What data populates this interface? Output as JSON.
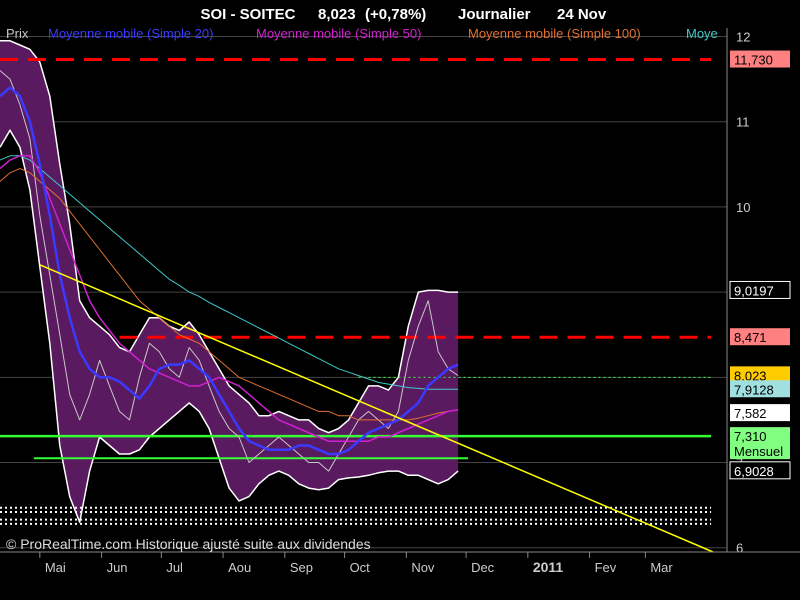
{
  "header": {
    "title": "SOI - SOITEC",
    "price": "8,023",
    "change": "(+0,78%)",
    "period": "Journalier",
    "date": "24 Nov"
  },
  "legend": [
    {
      "label": "Prix",
      "color": "#c8c8c8"
    },
    {
      "label": "Moyenne mobile (Simple 20)",
      "color": "#3a3aff"
    },
    {
      "label": "Moyenne mobile (Simple 50)",
      "color": "#d020d0"
    },
    {
      "label": "Moyenne mobile (Simple 100)",
      "color": "#e07030"
    },
    {
      "label": "Moye",
      "color": "#40c8c8"
    }
  ],
  "watermark": "© ProRealTime.com Historique ajusté suite aux dividendes",
  "colors": {
    "band_fill": "#5a1a60",
    "band_edge": "#ffffff",
    "price": "#c8c8c8",
    "ma20": "#3a3aff",
    "ma50": "#d020d0",
    "ma100": "#e07030",
    "ma200": "#40c8c8",
    "resistance": "#ff0000",
    "support": "#33ff33",
    "trendline": "#ffff00",
    "grid": "#444444",
    "axis_text": "#cccccc"
  },
  "chart_data": {
    "type": "line",
    "ylim": [
      5.95,
      12.1
    ],
    "y_ticks": [
      6,
      7,
      8,
      9,
      10,
      11,
      12
    ],
    "y_tick_labels": [
      "6",
      "7",
      "8",
      "9",
      "10",
      "11",
      "12"
    ],
    "x_ticks": [
      {
        "label": "Mai",
        "day": 0
      },
      {
        "label": "Jun",
        "day": 31
      },
      {
        "label": "Jul",
        "day": 61
      },
      {
        "label": "Aou",
        "day": 92
      },
      {
        "label": "Sep",
        "day": 123
      },
      {
        "label": "Oct",
        "day": 153
      },
      {
        "label": "Nov",
        "day": 184
      },
      {
        "label": "Dec",
        "day": 214
      },
      {
        "label": "2011",
        "day": 245,
        "bold": true
      },
      {
        "label": "Fev",
        "day": 276
      },
      {
        "label": "Mar",
        "day": 304
      }
    ],
    "xlim_days": [
      -20,
      345
    ],
    "price_labels": [
      {
        "value": 11.73,
        "text": "11,730",
        "bg": "#ff8080",
        "fg": "#000000"
      },
      {
        "value": 9.0197,
        "text": "9,0197",
        "bg": "#000000",
        "fg": "#ffffff",
        "border": "#ffffff"
      },
      {
        "value": 8.471,
        "text": "8,471",
        "bg": "#ff8080",
        "fg": "#000000"
      },
      {
        "value": 8.023,
        "text": "8,023",
        "bg": "#ffcc00",
        "fg": "#000000"
      },
      {
        "value": 7.86,
        "text": "7,9128",
        "bg": "#a0e0e0",
        "fg": "#000000"
      },
      {
        "value": 7.58,
        "text": "7,582",
        "bg": "#ffffff",
        "fg": "#000000"
      },
      {
        "value": 7.31,
        "text": "7,310",
        "bg": "#80ff80",
        "fg": "#000000",
        "sub": "Mensuel"
      },
      {
        "value": 6.9028,
        "text": "6,9028",
        "bg": "#000000",
        "fg": "#ffffff",
        "border": "#ffffff"
      }
    ],
    "resistance_lines": [
      {
        "value": 11.73,
        "day_from": -20,
        "day_to": 337
      },
      {
        "value": 8.471,
        "day_from": 40,
        "day_to": 337
      }
    ],
    "support_lines": [
      {
        "value": 7.31,
        "day_from": -20,
        "day_to": 337,
        "width": 2.5
      },
      {
        "value": 7.05,
        "day_from": -3,
        "day_to": 215,
        "width": 2
      }
    ],
    "dotted_lines": [
      {
        "value": 6.47,
        "day_from": -20,
        "day_to": 337
      },
      {
        "value": 6.42,
        "day_from": -20,
        "day_to": 337
      },
      {
        "value": 6.33,
        "day_from": -20,
        "day_to": 337
      },
      {
        "value": 6.28,
        "day_from": -20,
        "day_to": 337
      },
      {
        "value": 8.0,
        "day_from": 160,
        "day_to": 337,
        "color": "#33ff33",
        "width": 1
      }
    ],
    "trendline": {
      "from": [
        0,
        9.32
      ],
      "to": [
        338,
        5.95
      ]
    },
    "series": [
      {
        "name": "Prix",
        "key": "price",
        "days": [
          -20,
          -15,
          -10,
          -5,
          0,
          5,
          10,
          15,
          20,
          25,
          30,
          35,
          40,
          45,
          50,
          55,
          60,
          65,
          70,
          75,
          80,
          85,
          90,
          95,
          100,
          105,
          110,
          115,
          120,
          125,
          130,
          135,
          140,
          145,
          150,
          155,
          160,
          165,
          170,
          175,
          180,
          185,
          190,
          195,
          200,
          205,
          210
        ],
        "values": [
          11.6,
          11.5,
          11.2,
          10.8,
          9.9,
          9.2,
          8.5,
          7.8,
          7.5,
          7.8,
          8.2,
          7.9,
          7.6,
          7.5,
          8.0,
          8.4,
          8.3,
          8.1,
          8.0,
          8.35,
          8.2,
          7.9,
          7.6,
          7.4,
          7.3,
          7.0,
          7.1,
          7.2,
          7.3,
          7.2,
          7.1,
          7.0,
          7.0,
          6.9,
          7.1,
          7.3,
          7.5,
          7.6,
          7.5,
          7.4,
          7.6,
          8.2,
          8.6,
          8.9,
          8.3,
          8.1,
          8.02
        ]
      },
      {
        "name": "Moyenne mobile (Simple 20)",
        "key": "ma20",
        "days": [
          -20,
          -15,
          -10,
          -5,
          0,
          5,
          10,
          15,
          20,
          25,
          30,
          35,
          40,
          45,
          50,
          55,
          60,
          65,
          70,
          75,
          80,
          85,
          90,
          95,
          100,
          105,
          110,
          115,
          120,
          125,
          130,
          135,
          140,
          145,
          150,
          155,
          160,
          165,
          170,
          175,
          180,
          185,
          190,
          195,
          200,
          205,
          210
        ],
        "values": [
          11.3,
          11.4,
          11.3,
          11.0,
          10.5,
          9.9,
          9.2,
          8.7,
          8.3,
          8.1,
          8.0,
          8.0,
          7.95,
          7.85,
          7.75,
          7.9,
          8.1,
          8.15,
          8.15,
          8.2,
          8.1,
          8.0,
          7.8,
          7.6,
          7.4,
          7.25,
          7.2,
          7.15,
          7.15,
          7.15,
          7.2,
          7.2,
          7.15,
          7.1,
          7.1,
          7.15,
          7.25,
          7.35,
          7.4,
          7.45,
          7.5,
          7.6,
          7.7,
          7.9,
          8.0,
          8.1,
          8.15
        ]
      },
      {
        "name": "Moyenne mobile (Simple 50)",
        "key": "ma50",
        "days": [
          -20,
          -15,
          -10,
          -5,
          0,
          5,
          10,
          15,
          20,
          25,
          30,
          35,
          40,
          45,
          50,
          55,
          60,
          65,
          70,
          75,
          80,
          85,
          90,
          95,
          100,
          105,
          110,
          115,
          120,
          125,
          130,
          135,
          140,
          145,
          150,
          155,
          160,
          165,
          170,
          175,
          180,
          185,
          190,
          195,
          200,
          205,
          210
        ],
        "values": [
          10.45,
          10.55,
          10.6,
          10.6,
          10.4,
          10.1,
          9.8,
          9.5,
          9.2,
          8.9,
          8.7,
          8.55,
          8.4,
          8.3,
          8.2,
          8.1,
          8.05,
          8.0,
          7.95,
          7.9,
          7.9,
          7.95,
          8.0,
          7.95,
          7.9,
          7.8,
          7.7,
          7.6,
          7.5,
          7.45,
          7.4,
          7.35,
          7.3,
          7.25,
          7.25,
          7.25,
          7.25,
          7.25,
          7.3,
          7.3,
          7.35,
          7.4,
          7.45,
          7.5,
          7.55,
          7.6,
          7.62
        ]
      },
      {
        "name": "Moyenne mobile (Simple 100)",
        "key": "ma100",
        "days": [
          -20,
          -15,
          -10,
          -5,
          0,
          5,
          10,
          15,
          20,
          25,
          30,
          35,
          40,
          45,
          50,
          55,
          60,
          65,
          70,
          75,
          80,
          85,
          90,
          95,
          100,
          105,
          110,
          115,
          120,
          125,
          130,
          135,
          140,
          145,
          150,
          155,
          160,
          165,
          170,
          175,
          180,
          185,
          190,
          195,
          200,
          205,
          210
        ],
        "values": [
          10.3,
          10.4,
          10.45,
          10.4,
          10.3,
          10.2,
          10.1,
          9.95,
          9.8,
          9.65,
          9.5,
          9.35,
          9.2,
          9.05,
          8.9,
          8.8,
          8.7,
          8.6,
          8.5,
          8.45,
          8.4,
          8.3,
          8.2,
          8.1,
          8.0,
          7.95,
          7.9,
          7.85,
          7.8,
          7.75,
          7.7,
          7.65,
          7.6,
          7.6,
          7.55,
          7.55,
          7.5,
          7.5,
          7.5,
          7.5,
          7.5,
          7.5,
          7.52,
          7.55,
          7.58,
          7.6,
          7.62
        ]
      },
      {
        "name": "Moye",
        "key": "ma200",
        "days": [
          -20,
          -15,
          -10,
          -5,
          0,
          5,
          10,
          15,
          20,
          25,
          30,
          35,
          40,
          45,
          50,
          55,
          60,
          65,
          70,
          75,
          80,
          85,
          90,
          95,
          100,
          105,
          110,
          115,
          120,
          125,
          130,
          135,
          140,
          145,
          150,
          155,
          160,
          165,
          170,
          175,
          180,
          185,
          190,
          195,
          200,
          205,
          210
        ],
        "values": [
          10.55,
          10.6,
          10.6,
          10.55,
          10.45,
          10.35,
          10.25,
          10.15,
          10.05,
          9.95,
          9.85,
          9.75,
          9.65,
          9.55,
          9.45,
          9.35,
          9.25,
          9.15,
          9.08,
          9.0,
          8.95,
          8.88,
          8.82,
          8.76,
          8.7,
          8.64,
          8.58,
          8.52,
          8.46,
          8.4,
          8.34,
          8.28,
          8.22,
          8.16,
          8.1,
          8.06,
          8.02,
          7.98,
          7.94,
          7.92,
          7.9,
          7.88,
          7.87,
          7.86,
          7.86,
          7.86,
          7.86
        ]
      },
      {
        "name": "band_upper",
        "key": "band_upper",
        "days": [
          -20,
          -15,
          -10,
          -5,
          0,
          5,
          10,
          15,
          20,
          25,
          30,
          35,
          40,
          45,
          50,
          55,
          60,
          65,
          70,
          75,
          80,
          85,
          90,
          95,
          100,
          105,
          110,
          115,
          120,
          125,
          130,
          135,
          140,
          145,
          150,
          155,
          160,
          165,
          170,
          175,
          180,
          185,
          190,
          195,
          200,
          205,
          210
        ],
        "values": [
          11.95,
          11.95,
          11.9,
          11.85,
          11.7,
          11.3,
          10.5,
          9.8,
          8.9,
          8.7,
          8.6,
          8.5,
          8.35,
          8.3,
          8.5,
          8.7,
          8.7,
          8.6,
          8.55,
          8.65,
          8.5,
          8.3,
          8.1,
          7.9,
          7.8,
          7.7,
          7.55,
          7.55,
          7.6,
          7.55,
          7.5,
          7.5,
          7.4,
          7.35,
          7.4,
          7.5,
          7.7,
          7.9,
          7.9,
          7.85,
          8.0,
          8.6,
          9.0,
          9.02,
          9.02,
          9.0,
          9.0
        ]
      },
      {
        "name": "band_lower",
        "key": "band_lower",
        "days": [
          -20,
          -15,
          -10,
          -5,
          0,
          5,
          10,
          15,
          20,
          25,
          30,
          35,
          40,
          45,
          50,
          55,
          60,
          65,
          70,
          75,
          80,
          85,
          90,
          95,
          100,
          105,
          110,
          115,
          120,
          125,
          130,
          135,
          140,
          145,
          150,
          155,
          160,
          165,
          170,
          175,
          180,
          185,
          190,
          195,
          200,
          205,
          210
        ],
        "values": [
          10.7,
          10.9,
          10.7,
          10.2,
          9.3,
          8.4,
          7.2,
          6.6,
          6.3,
          6.9,
          7.3,
          7.2,
          7.1,
          7.1,
          7.15,
          7.3,
          7.4,
          7.5,
          7.6,
          7.7,
          7.6,
          7.4,
          7.05,
          6.7,
          6.55,
          6.6,
          6.75,
          6.85,
          6.9,
          6.85,
          6.75,
          6.7,
          6.68,
          6.7,
          6.8,
          6.82,
          6.83,
          6.85,
          6.88,
          6.9,
          6.9,
          6.85,
          6.85,
          6.8,
          6.75,
          6.8,
          6.9
        ]
      }
    ]
  }
}
